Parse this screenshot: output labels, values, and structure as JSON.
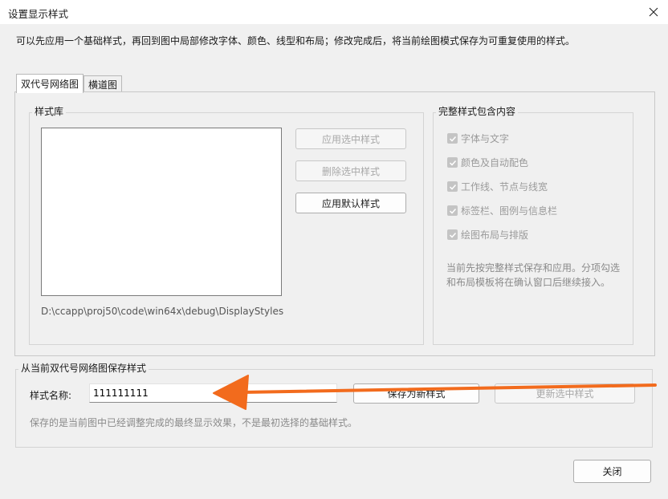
{
  "window": {
    "title": "设置显示样式",
    "close_icon": "close-icon"
  },
  "hint": "可以先应用一个基础样式，再回到图中局部修改字体、颜色、线型和布局；修改完成后，将当前绘图模式保存为可重复使用的样式。",
  "tabs": [
    {
      "label": "双代号网络图",
      "active": true
    },
    {
      "label": "横道图",
      "active": false
    }
  ],
  "library": {
    "group_label": "样式库",
    "items": [],
    "path": "D:\\ccapp\\proj50\\code\\win64x\\debug\\DisplayStyles",
    "buttons": {
      "apply_selected": "应用选中样式",
      "delete_selected": "删除选中样式",
      "apply_default": "应用默认样式"
    }
  },
  "contents": {
    "group_label": "完整样式包含内容",
    "options": [
      {
        "label": "字体与文字",
        "checked": true
      },
      {
        "label": "颜色及自动配色",
        "checked": true
      },
      {
        "label": "工作线、节点与线宽",
        "checked": true
      },
      {
        "label": "标签栏、图例与信息栏",
        "checked": true
      },
      {
        "label": "绘图布局与排版",
        "checked": true
      }
    ],
    "note": "当前先按完整样式保存和应用。分项勾选和布局模板将在确认窗口后继续接入。"
  },
  "save": {
    "group_label": "从当前双代号网络图保存样式",
    "name_label": "样式名称:",
    "name_value": "111111111",
    "save_new": "保存为新样式",
    "update_selected": "更新选中样式",
    "note": "保存的是当前图中已经调整完成的最终显示效果，不是最初选择的基础样式。"
  },
  "footer": {
    "close": "关闭"
  },
  "colors": {
    "arrow": "#f26b1d",
    "accent": "#0067c0"
  }
}
